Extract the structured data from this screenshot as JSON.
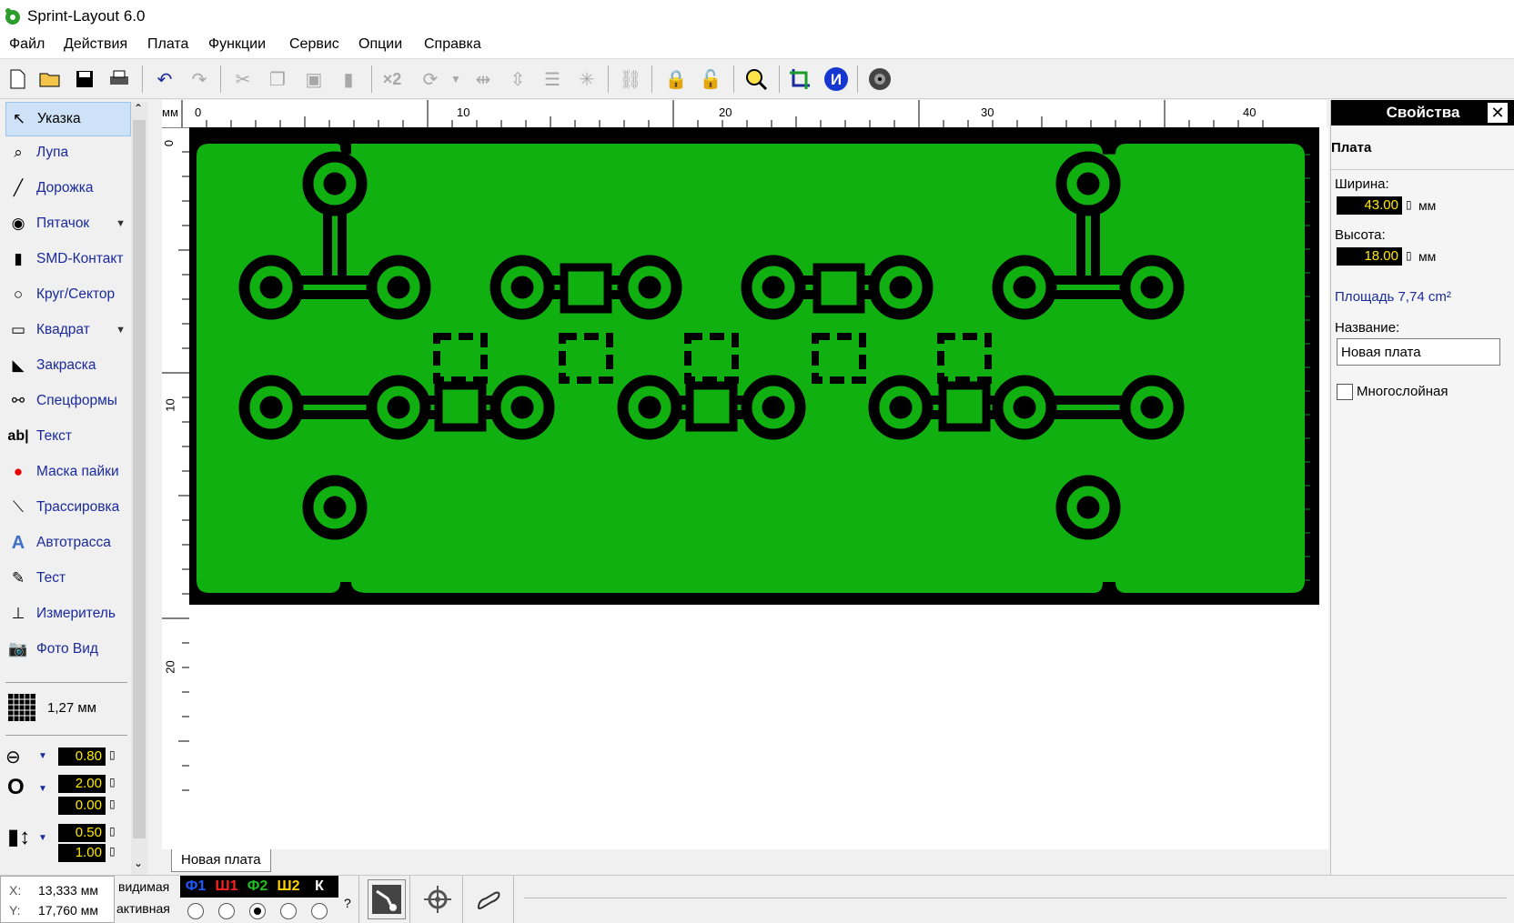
{
  "window": {
    "title": "Sprint-Layout 6.0"
  },
  "menu": [
    "Файл",
    "Действия",
    "Плата",
    "Функции",
    "Сервис",
    "Опции",
    "Справка"
  ],
  "toolbar": {
    "icons": [
      "new-file-icon",
      "open-folder-icon",
      "save-icon",
      "print-icon",
      "undo-icon",
      "redo-icon",
      "cut-icon",
      "copy-icon",
      "paste-icon",
      "delete-icon",
      "duplicate-icon",
      "rotate-icon",
      "mirror-horizontal-icon",
      "mirror-vertical-icon",
      "align-icon",
      "group-icon",
      "ungroup-icon",
      "connections-icon",
      "lock-icon",
      "unlock-icon",
      "zoom-icon",
      "crop-icon",
      "info-icon",
      "settings-icon"
    ],
    "duplicate_label": "×2"
  },
  "tools": [
    {
      "label": "Указка",
      "icon": "pointer-icon",
      "selected": true
    },
    {
      "label": "Лупа",
      "icon": "magnifier-icon"
    },
    {
      "label": "Дорожка",
      "icon": "track-icon"
    },
    {
      "label": "Пятачок",
      "icon": "pad-icon",
      "dropdown": true
    },
    {
      "label": "SMD-Контакт",
      "icon": "smd-pad-icon"
    },
    {
      "label": "Круг/Сектор",
      "icon": "circle-icon"
    },
    {
      "label": "Квадрат",
      "icon": "square-icon",
      "dropdown": true
    },
    {
      "label": "Закраска",
      "icon": "fill-icon"
    },
    {
      "label": "Спецформы",
      "icon": "special-forms-icon"
    },
    {
      "label": "Текст",
      "icon": "text-icon",
      "icon_text": "ab|"
    },
    {
      "label": "Маска пайки",
      "icon": "solder-mask-icon"
    },
    {
      "label": "Трассировка",
      "icon": "routing-icon"
    },
    {
      "label": "Автотрасса",
      "icon": "autoroute-icon"
    },
    {
      "label": "Тест",
      "icon": "test-icon"
    },
    {
      "label": "Измеритель",
      "icon": "measure-icon"
    },
    {
      "label": "Фото Вид",
      "icon": "photo-view-icon"
    }
  ],
  "grid": {
    "value": "1,27 мм"
  },
  "params": {
    "track_width": "0.80",
    "pad_outer": "2.00",
    "pad_inner": "0.00",
    "smd_width": "0.50",
    "smd_height": "1.00"
  },
  "ruler": {
    "unit": "мм",
    "h_labels": [
      "0",
      "10",
      "20",
      "30",
      "40"
    ],
    "v_labels": [
      "0",
      "10",
      "20"
    ]
  },
  "board_tab": "Новая плата",
  "properties": {
    "header": "Свойства",
    "close": "✕",
    "section": "Плата",
    "width_label": "Ширина:",
    "width_value": "43.00",
    "height_label": "Высота:",
    "height_value": "18.00",
    "unit": "мм",
    "area": "Площадь  7,74 cm²",
    "name_label": "Название:",
    "name_value": "Новая плата",
    "multilayer_label": "Многослойная",
    "multilayer_checked": false
  },
  "status": {
    "x_label": "X:",
    "x_value": "13,333 мм",
    "y_label": "Y:",
    "y_value": "17,760 мм",
    "visible_label": "видимая",
    "active_label": "активная",
    "help": "?",
    "layers": [
      {
        "label": "Ф1",
        "color": "#1e5aff"
      },
      {
        "label": "Ш1",
        "color": "#ff2020"
      },
      {
        "label": "Ф2",
        "color": "#20c020"
      },
      {
        "label": "Ш2",
        "color": "#ffd000"
      },
      {
        "label": "К",
        "color": "#ffffff"
      }
    ],
    "active_layer_index": 2
  },
  "colors": {
    "copper": "#10b010",
    "board": "#000000",
    "accent": "#1a2a9c"
  }
}
